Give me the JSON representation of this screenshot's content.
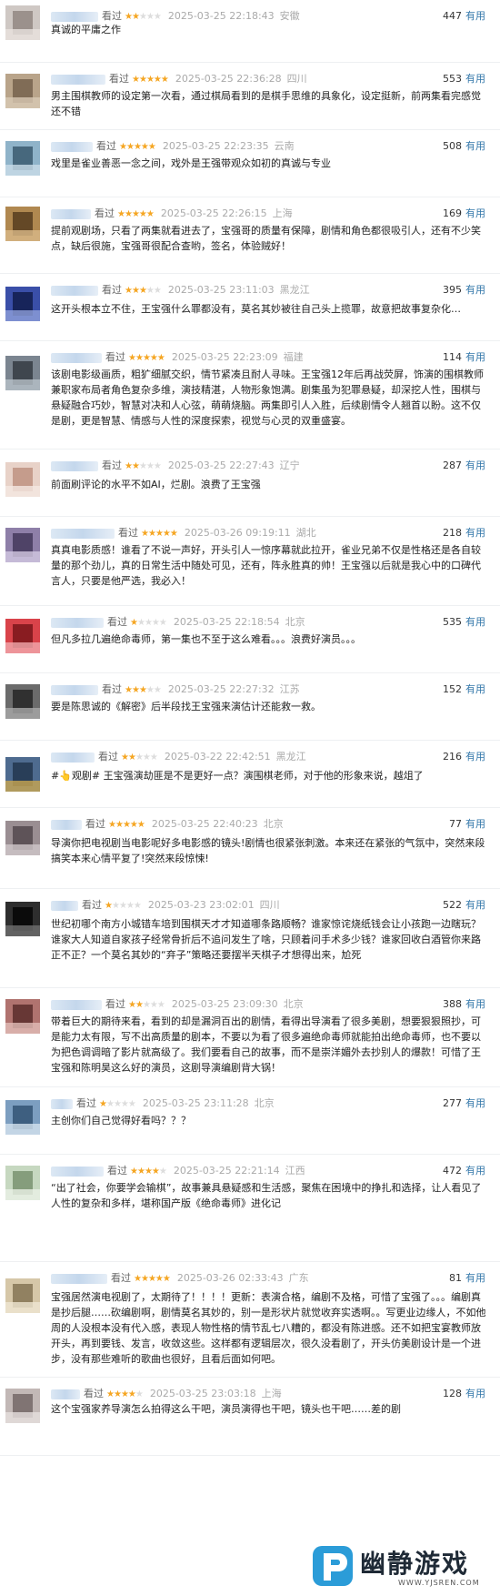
{
  "comments": [
    {
      "watched": "看过",
      "rating": 2,
      "time": "2025-03-25 22:18:43",
      "loc": "安徽",
      "votes": "447",
      "useful": "有用",
      "text": "真诚的平庸之作",
      "avatar": [
        "#cfc8c4",
        "#8a7f7a",
        "#e8e2de"
      ]
    },
    {
      "watched": "看过",
      "rating": 5,
      "time": "2025-03-25 22:36:28",
      "loc": "四川",
      "votes": "553",
      "useful": "有用",
      "text": "男主围棋教师的设定第一次看，通过棋局看到的是棋手思维的具象化，设定挺新，前两集看完感觉还不错",
      "avatar": [
        "#b9a48a",
        "#6e5a44",
        "#d8c9b4"
      ]
    },
    {
      "watched": "看过",
      "rating": 5,
      "time": "2025-03-25 22:23:35",
      "loc": "云南",
      "votes": "508",
      "useful": "有用",
      "text": "戏里是雀业善恶一念之间，戏外是王强带观众如初的真诚与专业",
      "avatar": [
        "#8fb3c9",
        "#2f4f63",
        "#c9dce8"
      ]
    },
    {
      "watched": "看过",
      "rating": 5,
      "time": "2025-03-25 22:26:15",
      "loc": "上海",
      "votes": "169",
      "useful": "有用",
      "text": "提前观剧场，只看了两集就看进去了，宝强哥的质量有保障，剧情和角色都很吸引人，还有不少笑点，缺后很施，宝强哥很配合查哟，签名，体验贼好！",
      "avatar": [
        "#b08850",
        "#4b3318",
        "#d9b988"
      ]
    },
    {
      "watched": "看过",
      "rating": 3,
      "time": "2025-03-25 23:11:03",
      "loc": "黑龙江",
      "votes": "395",
      "useful": "有用",
      "text": "这开头根本立不住，王宝强什么罪都没有，莫名其妙被往自己头上揽罪，故意把故事复杂化…",
      "avatar": [
        "#3a4fa8",
        "#0c1640",
        "#8f9fd9"
      ]
    },
    {
      "watched": "看过",
      "rating": 5,
      "time": "2025-03-25 22:23:09",
      "loc": "福建",
      "votes": "114",
      "useful": "有用",
      "text": "该剧电影级画质，粗犷细腻交织，情节紧凑且耐人寻味。王宝强12年后再战荧屏，饰演的围棋教师兼职家布局者角色复杂多维，演技精湛，人物形象饱满。剧集虽为犯罪悬疑，却深挖人性，围棋与悬疑融合巧妙，智慧对决和人心弦，萌萌烧脑。两集即引人入胜，后续剧情令人翘首以盼。这不仅是剧，更是智慧、情感与人性的深度探索，视觉与心灵的双重盛宴。",
      "avatar": [
        "#7b8590",
        "#2b3138",
        "#b8c0c8"
      ]
    },
    {
      "watched": "看过",
      "rating": 2,
      "time": "2025-03-25 22:27:43",
      "loc": "辽宁",
      "votes": "287",
      "useful": "有用",
      "text": "前面刷评论的水平不如AI，烂剧。浪费了王宝强",
      "avatar": [
        "#e8d2c8",
        "#b98a78",
        "#f4e8e2"
      ]
    },
    {
      "watched": "看过",
      "rating": 5,
      "time": "2025-03-26 09:19:11",
      "loc": "湖北",
      "votes": "218",
      "useful": "有用",
      "text": "真真电影质感！谁看了不说一声好，开头引人一惊序幕就此拉开，雀业兄弟不仅是性格还是各自较量的那个劲儿，真的日常生活中随处可见，还有，阵永胜真的帅！王宝强以后就是我心中的口碑代言人，只要是他严选，我必入！",
      "avatar": [
        "#8e7fa8",
        "#3a2f52",
        "#d3c9e2"
      ]
    },
    {
      "watched": "看过",
      "rating": 1,
      "time": "2025-03-25 22:18:54",
      "loc": "北京",
      "votes": "535",
      "useful": "有用",
      "text": "但凡多拉几遍绝命毒师，第一集也不至于这么难看。。。浪费好演员。。。",
      "avatar": [
        "#d9434a",
        "#6e0f14",
        "#f1a9ad"
      ]
    },
    {
      "watched": "看过",
      "rating": 3,
      "time": "2025-03-25 22:27:32",
      "loc": "江苏",
      "votes": "152",
      "useful": "有用",
      "text": "要是陈思诚的《解密》后半段找王宝强来演估计还能救一救。",
      "avatar": [
        "#6b6b6b",
        "#1c1c1c",
        "#a9a9a9"
      ]
    },
    {
      "watched": "看过",
      "rating": 2,
      "time": "2025-03-22 22:42:51",
      "loc": "黑龙江",
      "votes": "216",
      "useful": "有用",
      "text": "#👆观剧# 王宝强演劫匪是不是更好一点？演围棋老师，对于他的形象来说，越俎了",
      "avatar": [
        "#4e6b8f",
        "#1d2f45",
        "#c9a650"
      ]
    },
    {
      "watched": "看过",
      "rating": 5,
      "time": "2025-03-25 22:40:23",
      "loc": "北京",
      "votes": "77",
      "useful": "有用",
      "text": "导演你把电视剧当电影呢好多电影感的镜头!剧情也很紧张刺激。本来还在紧张的气氛中，突然来段搞笑本来心情平复了!突然来段惊悚!",
      "avatar": [
        "#9a8e92",
        "#4a3f44",
        "#d0c8cb"
      ]
    },
    {
      "watched": "看过",
      "rating": 1,
      "time": "2025-03-23 23:02:01",
      "loc": "四川",
      "votes": "522",
      "useful": "有用",
      "text": "世纪初哪个南方小城错车培到围棋天才才知道哪条路顺畅？谁家惊诧烧纸钱会让小孩跑一边瞎玩？谁家大人知道自家孩子经常骨折后不追问发生了啥，只顾着问手术多少钱？谁家回收白酒管你来路正不正？一个莫名其妙的“弃子”策略还要摆半天棋子才想得出来，尬死",
      "avatar": [
        "#2e2e2e",
        "#000000",
        "#6f6f6f"
      ]
    },
    {
      "watched": "看过",
      "rating": 2,
      "time": "2025-03-25 23:09:30",
      "loc": "北京",
      "votes": "388",
      "useful": "有用",
      "text": "带着巨大的期待来看，看到的却是漏洞百出的剧情，看得出导演看了很多美剧，想要狠狠照抄，可是能力太有限，写不出高质量的剧本，不要以为看了很多遍绝命毒师就能拍出绝命毒师，也不要以为把色调调暗了影片就高级了。我们要看自己的故事，而不是崇洋媚外去抄别人的爆款！可惜了王宝强和陈明昊这么好的演员，这剧导演编剧背大锅！",
      "avatar": [
        "#b0736f",
        "#4f2321",
        "#e2bdb8"
      ]
    },
    {
      "watched": "看过",
      "rating": 1,
      "time": "2025-03-25 23:11:28",
      "loc": "北京",
      "votes": "277",
      "useful": "有用",
      "text": "主创你们自己觉得好看吗？？？",
      "avatar": [
        "#7c9ec0",
        "#2a4a6b",
        "#d5e2ee"
      ]
    },
    {
      "watched": "看过",
      "rating": 4,
      "time": "2025-03-25 22:21:14",
      "loc": "江西",
      "votes": "472",
      "useful": "有用",
      "text": "“出了社会，你要学会输棋”，故事兼具悬疑感和生活感，聚焦在困境中的挣扎和选择，让人看见了人性的复杂和多样，堪称国产版《绝命毒师》进化记",
      "avatar": [
        "#c6d8c0",
        "#6f8a66",
        "#eaf1e6"
      ]
    },
    {
      "watched": "看过",
      "rating": 5,
      "time": "2025-03-26 02:33:43",
      "loc": "广东",
      "votes": "81",
      "useful": "有用",
      "text": "宝强居然演电视剧了，太期待了！！！！更新：表演合格，编剧不及格，可惜了宝强了。。。编剧真是抄后腿……砍编剧啊，剧情莫名其妙的，别一是形状片就觉收弃实透啊。。写更业边缘人，不如他周的人没根本没有代入感，表现人物性格的情节乱七八糟的，都没有陈进感。还不如把宝宴教师放开头，再到要钱、发言，收敛这些。这样都有逻辑层次，很久没看剧了，开头仿美剧设计是一个进步，没有那些难听的歌曲也很好，且看后面如何吧。",
      "avatar": [
        "#d6c7a8",
        "#7a6a4a",
        "#efe6d2"
      ]
    },
    {
      "watched": "看过",
      "rating": 4,
      "time": "2025-03-25 23:03:18",
      "loc": "上海",
      "votes": "128",
      "useful": "有用",
      "text": "这个宝强家养导演怎么拍得这么干吧，演员演得也干吧，镜头也干吧……差的剧",
      "avatar": [
        "#c2b8b6",
        "#6a5e5c",
        "#e6e0df"
      ]
    }
  ],
  "watermark": {
    "title": "幽静游戏",
    "url": "WWW.YJSREN.COM"
  }
}
